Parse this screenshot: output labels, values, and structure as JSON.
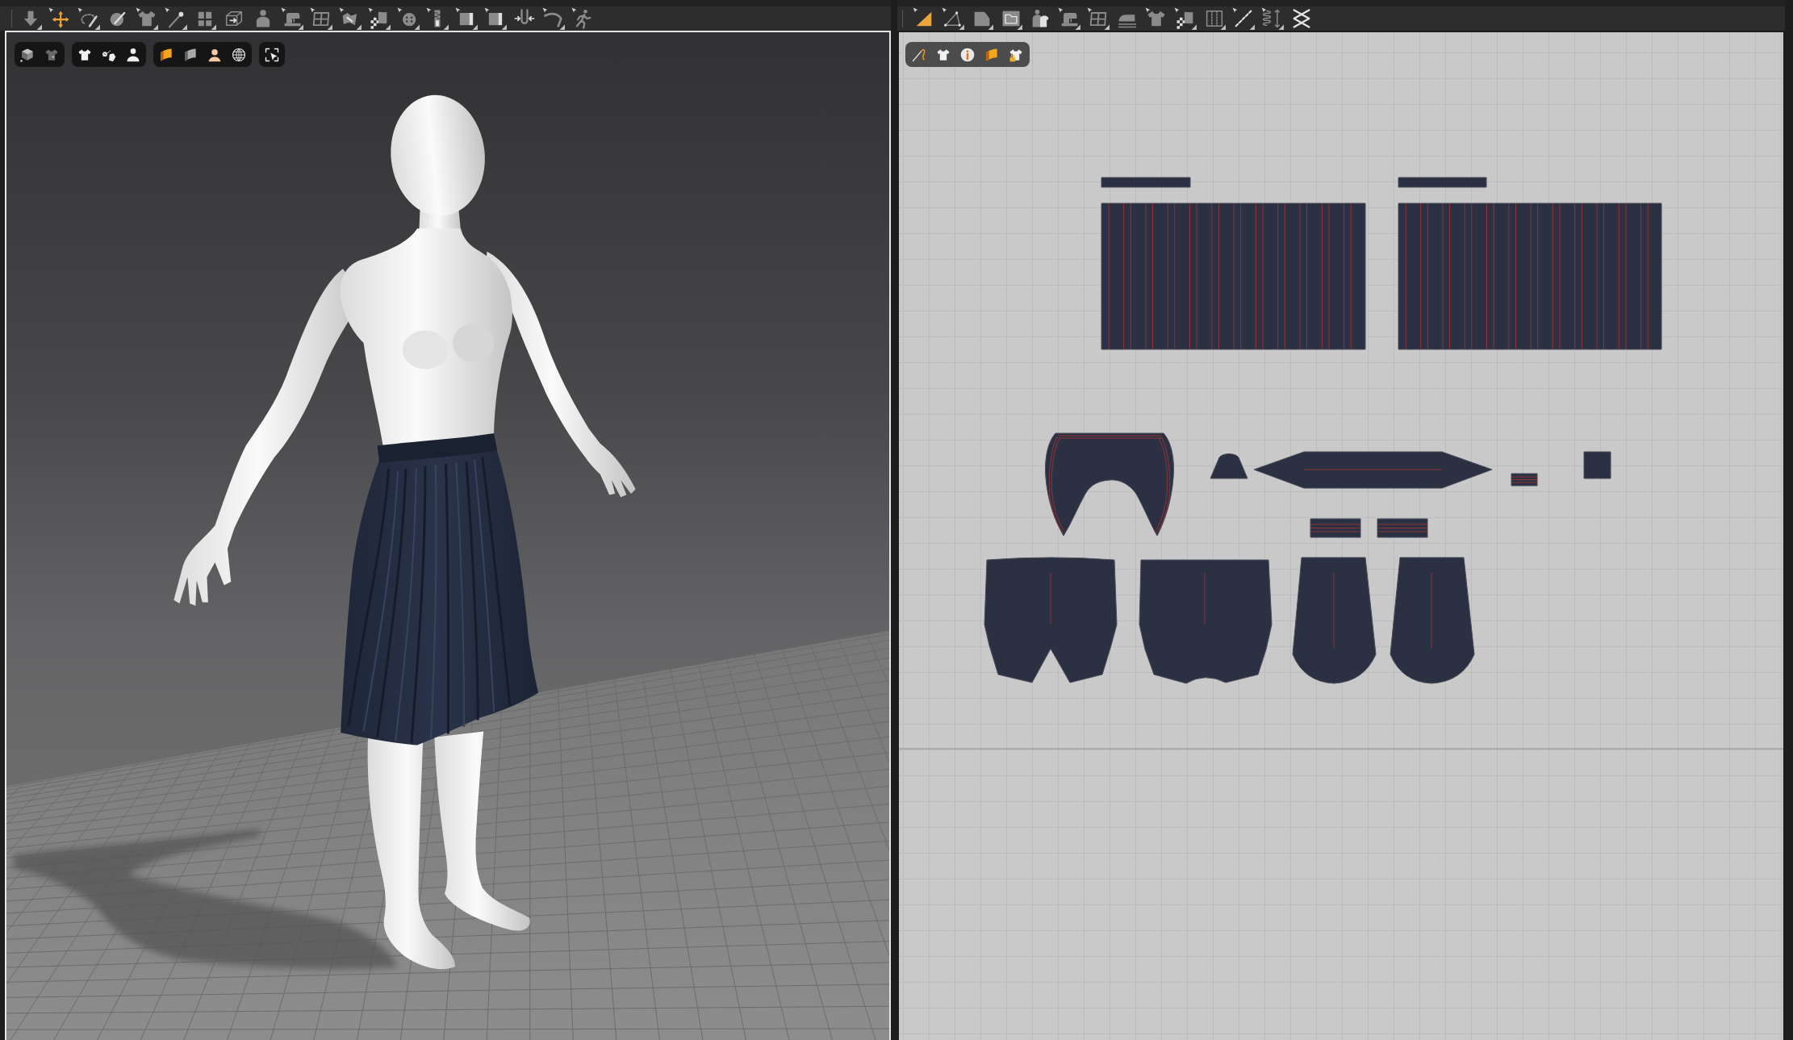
{
  "panes": [
    {
      "kind": "scene",
      "toolbar": {
        "tools": [
          {
            "selected": false,
            "flyout": true
          },
          {
            "selected": true,
            "flyout": false
          },
          {
            "selected": false,
            "flyout": true
          },
          {
            "selected": false,
            "flyout": false
          },
          {
            "selected": false,
            "flyout": true
          },
          {
            "selected": false,
            "flyout": true
          },
          {
            "selected": false,
            "flyout": true
          },
          {
            "selected": false,
            "flyout": false
          },
          {
            "selected": false,
            "flyout": false
          },
          {
            "selected": false,
            "flyout": true
          },
          {
            "selected": false,
            "flyout": true
          },
          {
            "selected": false,
            "flyout": true
          },
          {
            "selected": false,
            "flyout": true
          },
          {
            "selected": false,
            "flyout": true
          },
          {
            "selected": false,
            "flyout": true
          },
          {
            "selected": false,
            "flyout": true
          },
          {
            "selected": false,
            "flyout": true
          },
          {
            "selected": false,
            "flyout": false
          },
          {
            "selected": false,
            "flyout": true
          },
          {
            "selected": false,
            "flyout": false
          }
        ]
      },
      "viewport": {
        "focused": true
      }
    },
    {
      "kind": "pattern",
      "toolbar": {
        "tools": [
          {
            "selected": true,
            "flyout": false
          },
          {
            "selected": false,
            "flyout": true
          },
          {
            "selected": false,
            "flyout": true
          },
          {
            "selected": false,
            "flyout": true
          },
          {
            "selected": false,
            "flyout": false
          },
          {
            "selected": false,
            "flyout": true
          },
          {
            "selected": false,
            "flyout": true
          },
          {
            "selected": false,
            "flyout": false
          },
          {
            "selected": false,
            "flyout": false
          },
          {
            "selected": false,
            "flyout": true
          },
          {
            "selected": false,
            "flyout": true
          },
          {
            "selected": false,
            "flyout": true
          },
          {
            "selected": false,
            "flyout": true
          },
          {
            "selected": false,
            "flyout": false
          }
        ]
      },
      "viewport": {
        "focused": false
      }
    }
  ]
}
